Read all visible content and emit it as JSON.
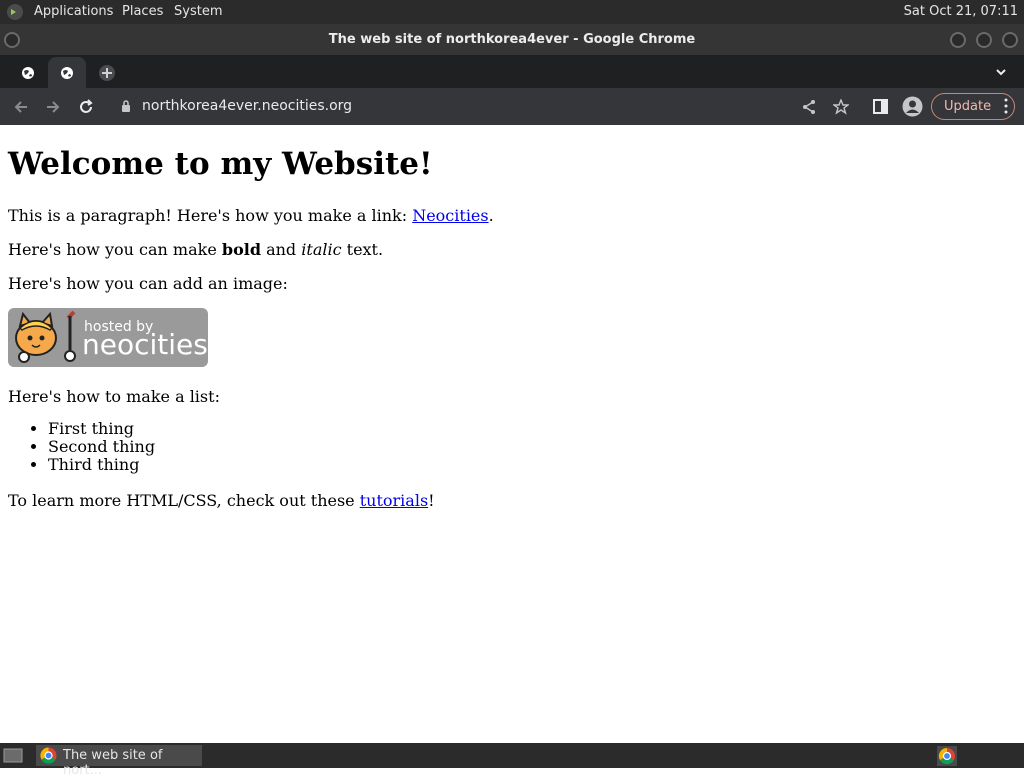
{
  "top_panel": {
    "menus": [
      "Applications",
      "Places",
      "System"
    ],
    "clock": "Sat Oct 21, 07:11"
  },
  "window": {
    "title": "The web site of northkorea4ever - Google Chrome"
  },
  "toolbar": {
    "url": "northkorea4ever.neocities.org",
    "update_label": "Update"
  },
  "page": {
    "heading": "Welcome to my Website!",
    "p1_text": "This is a paragraph! Here's how you make a link: ",
    "p1_link": "Neocities",
    "p1_end": ".",
    "p2_start": "Here's how you can make ",
    "p2_bold": "bold",
    "p2_mid": " and ",
    "p2_italic": "italic",
    "p2_end": " text.",
    "p3": "Here's how you can add an image:",
    "badge_hosted": "hosted by",
    "badge_brand": "neocities",
    "p4": "Here's how to make a list:",
    "list": [
      "First thing",
      "Second thing",
      "Third thing"
    ],
    "p5_text": "To learn more HTML/CSS, check out these ",
    "p5_link": "tutorials",
    "p5_end": "!"
  },
  "taskbar": {
    "item": "The web site of nort..."
  },
  "colors": {
    "panel_bg": "#2b2b2b",
    "chrome_dark": "#35363a",
    "tabstrip_bg": "#1f2022",
    "link": "#0000ee",
    "update_border": "#c6867a"
  }
}
